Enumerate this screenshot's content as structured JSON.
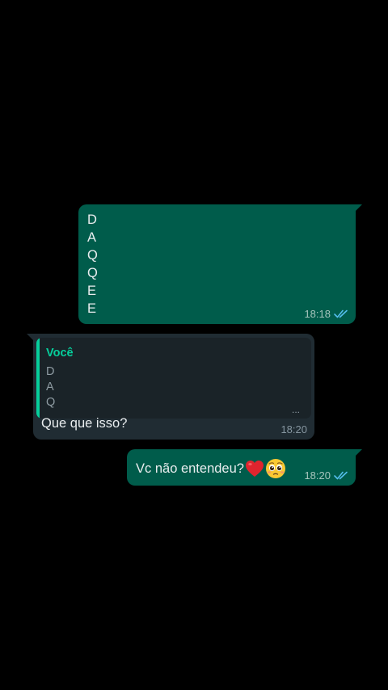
{
  "messages": [
    {
      "direction": "outgoing",
      "lines": [
        "D",
        "A",
        "Q",
        "Q",
        "E",
        "E"
      ],
      "time": "18:18",
      "status": "read",
      "status_icon": "double-check-icon"
    },
    {
      "direction": "incoming",
      "quote": {
        "author": "Você",
        "lines": [
          "D",
          "A",
          "Q"
        ],
        "more": "..."
      },
      "text": "Que que isso?",
      "time": "18:20"
    },
    {
      "direction": "outgoing",
      "text": "Vc não entendeu?",
      "emojis": [
        "red-heart-icon",
        "pleading-face-icon"
      ],
      "time": "18:20",
      "status": "read",
      "status_icon": "double-check-icon"
    }
  ],
  "colors": {
    "background": "#000000",
    "outgoing_bubble": "#005c4b",
    "incoming_bubble": "#202c33",
    "quote_accent": "#06cf9c",
    "read_tick": "#53bdeb"
  }
}
